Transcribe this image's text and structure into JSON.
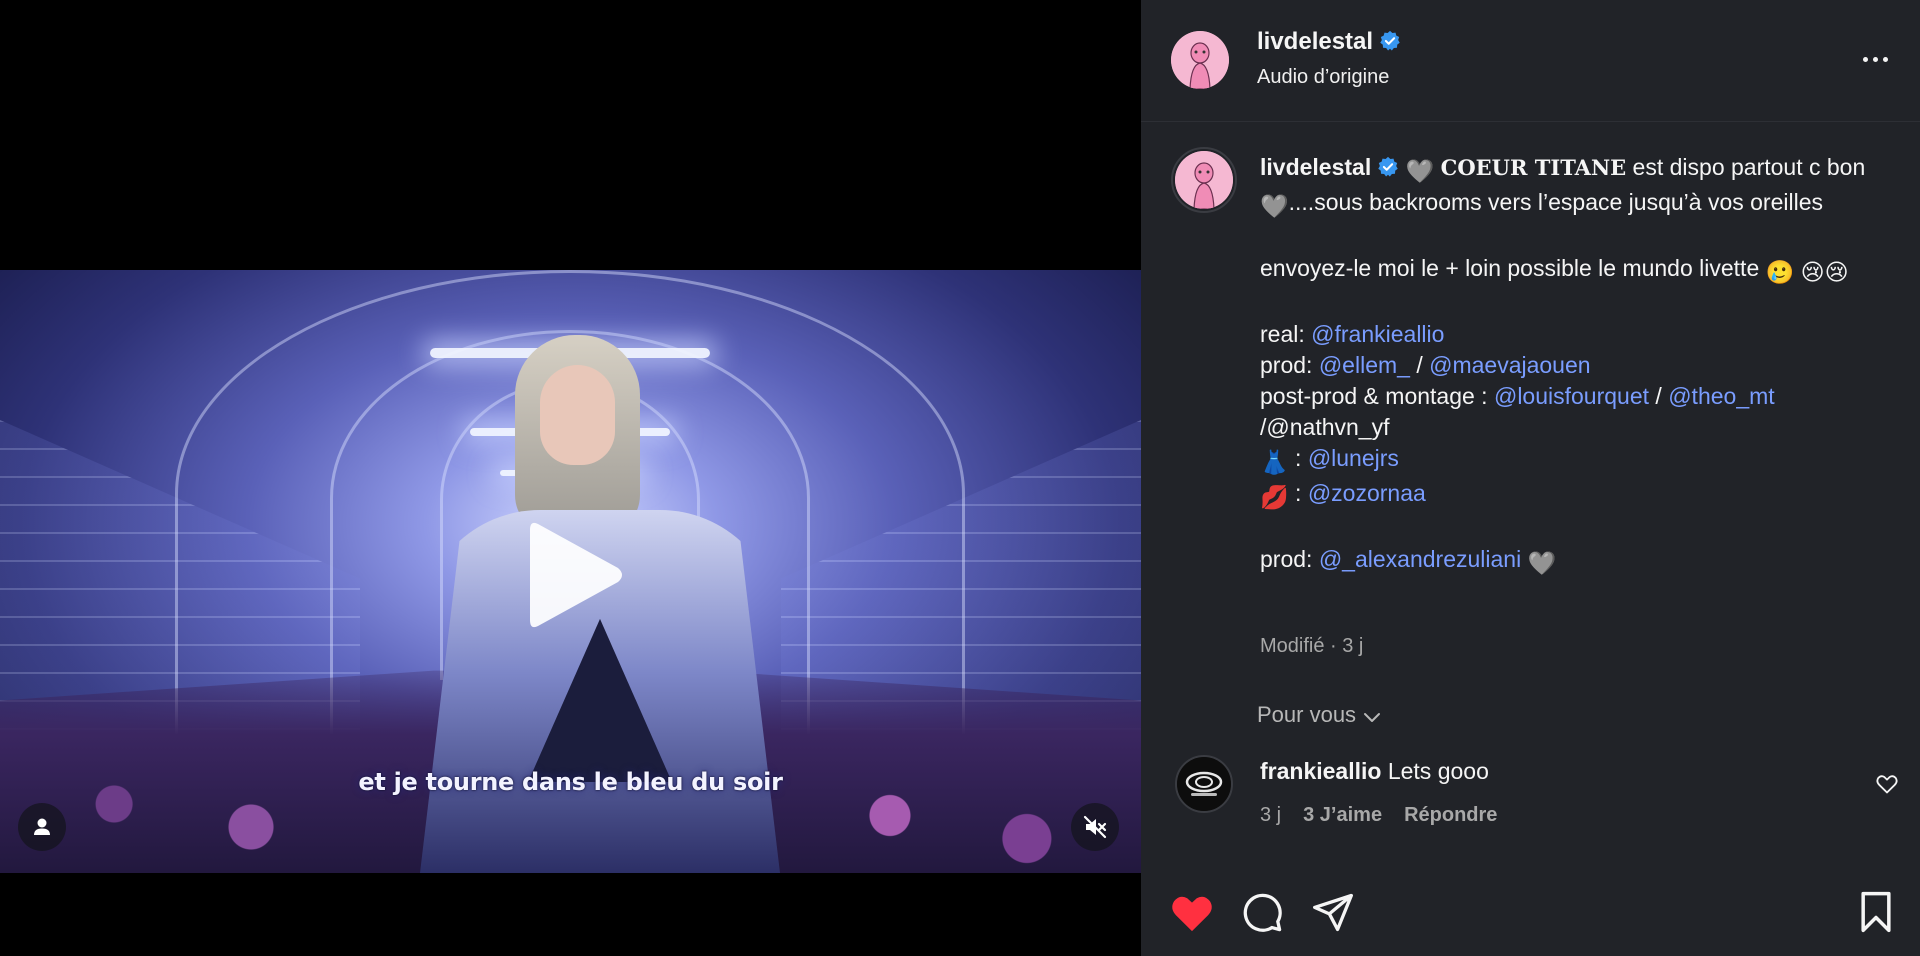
{
  "video": {
    "subtitle": "et je tourne dans le bleu du soir",
    "icons": {
      "play": "play-icon",
      "tag_user": "user-tag-icon",
      "mute": "speaker-muted-icon"
    }
  },
  "header": {
    "username": "livdelestal",
    "audio": "Audio d’origine",
    "more_icon": "more-horizontal-icon"
  },
  "caption": {
    "username": "livdelestal",
    "heart_emoji": "🩶",
    "title": "COEUR TITANE",
    "line1_rest": " est dispo partout c bon ",
    "line1_tail": "....sous backrooms vers l’espace jusqu’à vos oreilles",
    "line2": "envoyez-le moi le + loin possible le mundo livette ",
    "tear_emoji": "🥲",
    "cry_emoji": "😢",
    "credits": {
      "real_label": "real: ",
      "real": "@frankieallio",
      "prod_label": "prod: ",
      "prod_1": "@ellem_",
      "sep": " / ",
      "prod_2": "@maevajaouen",
      "postprod_label": "post-prod & montage : ",
      "postprod_1": "@louisfourquet",
      "postprod_2": "@theo_mt",
      "postprod_3": "/@nathvn_yf",
      "dress_emoji": "👗",
      "dress": "@lunejrs",
      "lips_emoji": "💋",
      "lips": "@zozornaa",
      "colon": " : ",
      "prod2_label": "prod: ",
      "prod2": "@_alexandrezuliani"
    },
    "meta": "Modifié · 3 j"
  },
  "pour_vous": "Pour vous",
  "comment": {
    "username": "frankieallio",
    "text": " Lets gooo",
    "time": "3 j",
    "likes": "3 J’aime",
    "reply": "Répondre"
  },
  "actions": {
    "like_icon": "heart-filled-icon",
    "comment_icon": "comment-icon",
    "share_icon": "send-icon",
    "save_icon": "bookmark-icon"
  },
  "colors": {
    "panel_bg": "#212328",
    "mention": "#7a9dff",
    "verified": "#3897f0",
    "like": "#ff3040"
  }
}
